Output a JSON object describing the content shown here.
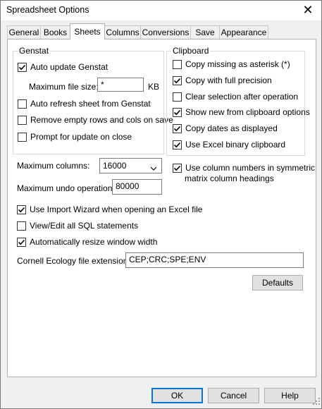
{
  "window": {
    "title": "Spreadsheet Options",
    "close": "✕"
  },
  "tabs": [
    {
      "label": "General"
    },
    {
      "label": "Books"
    },
    {
      "label": "Sheets"
    },
    {
      "label": "Columns"
    },
    {
      "label": "Conversions"
    },
    {
      "label": "Save"
    },
    {
      "label": "Appearance"
    }
  ],
  "active_tab": "Sheets",
  "genstat": {
    "title": "Genstat",
    "auto_update": {
      "label": "Auto update Genstat",
      "checked": true
    },
    "max_file_size_label": "Maximum file size:",
    "max_file_size_value": "*",
    "max_file_size_unit": "KB",
    "auto_refresh": {
      "label": "Auto refresh sheet from Genstat",
      "checked": false
    },
    "remove_empty": {
      "label": "Remove empty rows and cols on save",
      "checked": false
    },
    "prompt_update": {
      "label": "Prompt for update on close",
      "checked": false
    }
  },
  "clipboard": {
    "title": "Clipboard",
    "items": [
      {
        "label": "Copy missing as asterisk (*)",
        "checked": false
      },
      {
        "label": "Copy with full precision",
        "checked": true
      },
      {
        "label": "Clear selection after operation",
        "checked": false
      },
      {
        "label": "Show new from clipboard options",
        "checked": true
      },
      {
        "label": "Copy dates as displayed",
        "checked": true
      },
      {
        "label": "Use Excel binary clipboard",
        "checked": true
      }
    ]
  },
  "max_columns": {
    "label": "Maximum columns:",
    "value": "16000"
  },
  "max_undo": {
    "label": "Maximum undo operations:",
    "value": "80000"
  },
  "symmetric": {
    "label_line1": "Use column numbers in symmetric",
    "label_line2": "matrix column headings",
    "checked": true
  },
  "import_wizard": {
    "label": "Use Import Wizard when opening an Excel file",
    "checked": true
  },
  "view_sql": {
    "label": "View/Edit all SQL statements",
    "checked": false
  },
  "auto_resize": {
    "label": "Automatically resize window width",
    "checked": true
  },
  "cornell": {
    "label": "Cornell Ecology file extensions:",
    "value": "CEP;CRC;SPE;ENV"
  },
  "buttons": {
    "defaults": "Defaults",
    "ok": "OK",
    "cancel": "Cancel",
    "help": "Help"
  }
}
